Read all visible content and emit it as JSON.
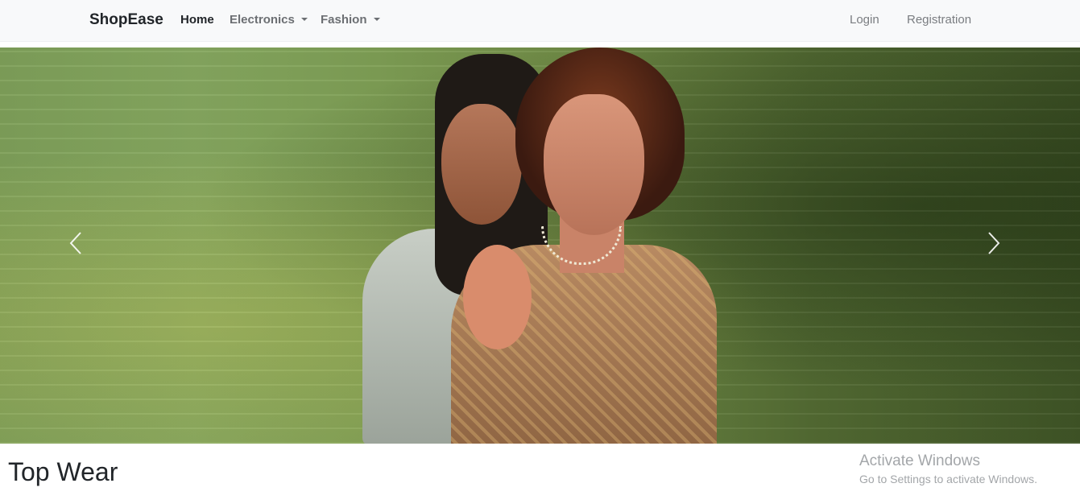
{
  "navbar": {
    "brand": "ShopEase",
    "items": [
      {
        "label": "Home",
        "active": true
      },
      {
        "label": "Electronics",
        "dropdown": true
      },
      {
        "label": "Fashion",
        "dropdown": true
      }
    ],
    "right": [
      {
        "label": "Login"
      },
      {
        "label": "Registration"
      }
    ]
  },
  "carousel": {
    "prev_icon": "chevron-left-icon",
    "next_icon": "chevron-right-icon"
  },
  "section": {
    "title": "Top Wear"
  },
  "watermark": {
    "title": "Activate Windows",
    "subtitle": "Go to Settings to activate Windows."
  }
}
